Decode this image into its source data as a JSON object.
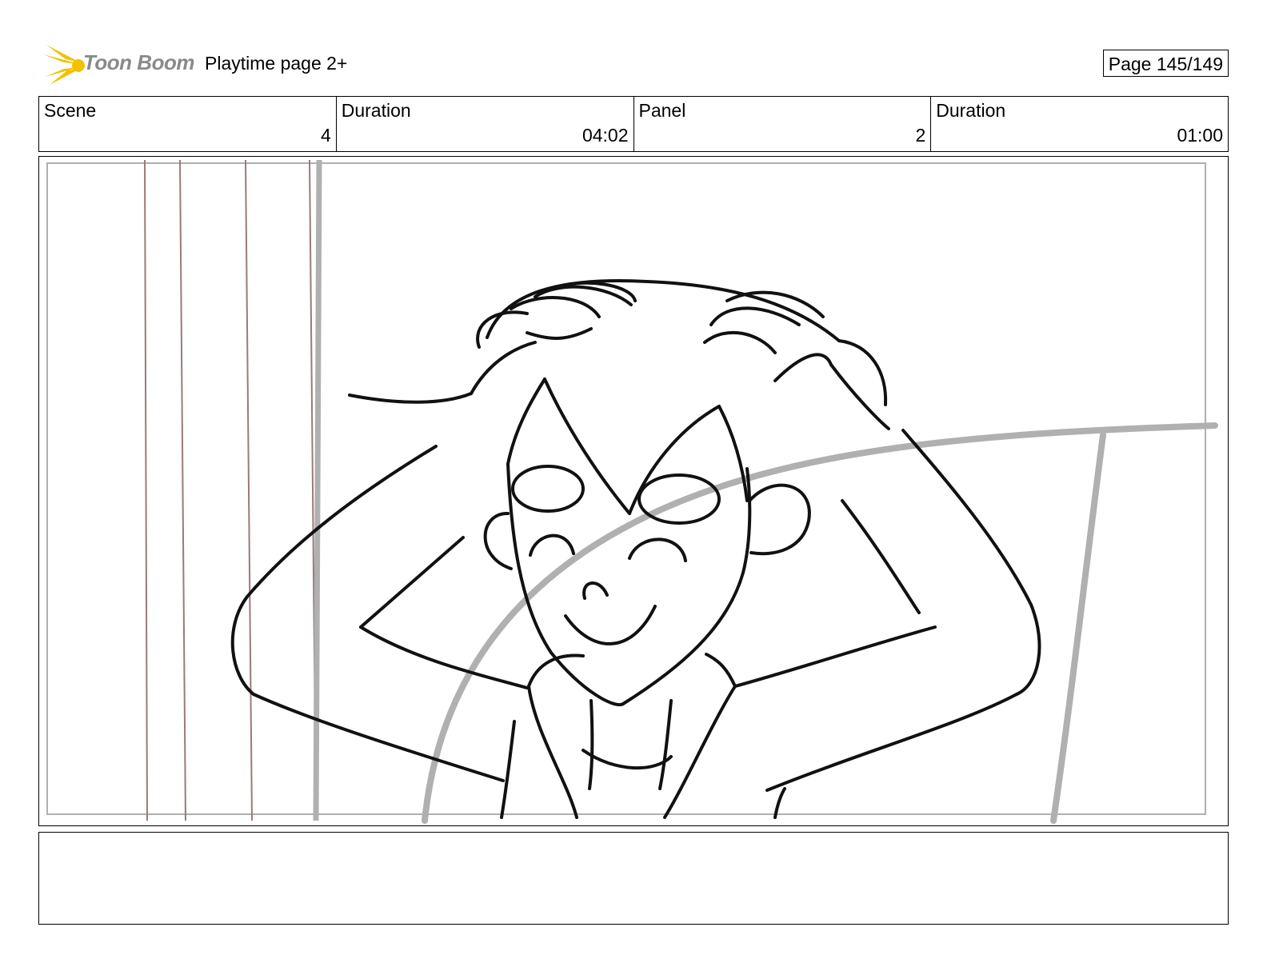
{
  "header": {
    "logo_text": "Toon Boom",
    "logo_color": "#f2c200",
    "title": "Playtime page 2+",
    "page_label": "Page 145/149"
  },
  "info": {
    "scene_label": "Scene",
    "scene_value": "4",
    "scene_duration_label": "Duration",
    "scene_duration_value": "04:02",
    "panel_label": "Panel",
    "panel_value": "2",
    "panel_duration_label": "Duration",
    "panel_duration_value": "01:00"
  },
  "panel": {
    "description": "",
    "line_color": "#111111",
    "guide_color": "#b0b0b0",
    "post_color": "#9a7a7a"
  },
  "notes": {
    "text": ""
  }
}
